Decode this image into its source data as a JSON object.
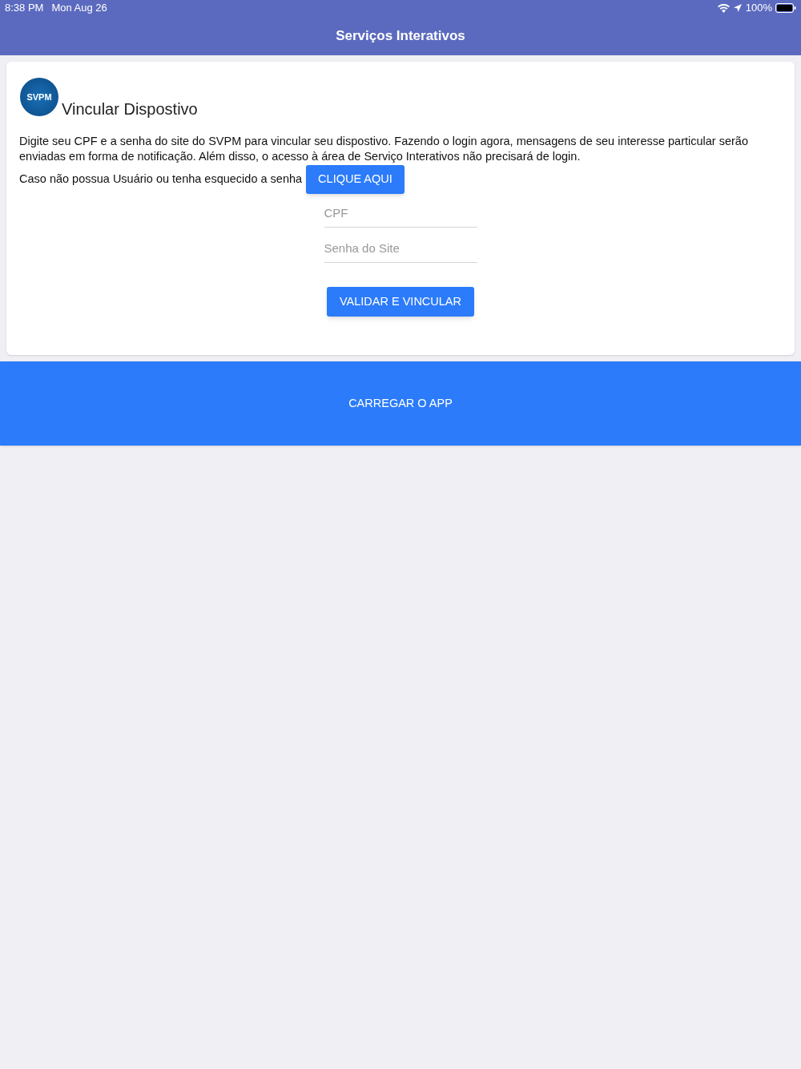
{
  "status_bar": {
    "time": "8:38 PM",
    "date": "Mon Aug 26",
    "battery": "100%"
  },
  "nav_bar": {
    "title": "Serviços Interativos"
  },
  "card": {
    "logo_text": "SVPM",
    "title": "Vincular Dispostivo",
    "description": "Digite seu CPF e a senha do site do SVPM para vincular seu dispostivo. Fazendo o login agora, mensagens de seu interesse particular serão enviadas em forma de notificação. Além disso, o acesso à área de Serviço Interativos não precisará de login.",
    "help_text": "Caso não possua Usuário ou tenha esquecido a senha",
    "help_button": "CLIQUE AQUI",
    "fields": [
      {
        "placeholder": "CPF"
      },
      {
        "placeholder": "Senha do Site"
      }
    ],
    "submit_button": "VALIDAR E VINCULAR"
  },
  "load_button": "CARREGAR O APP"
}
